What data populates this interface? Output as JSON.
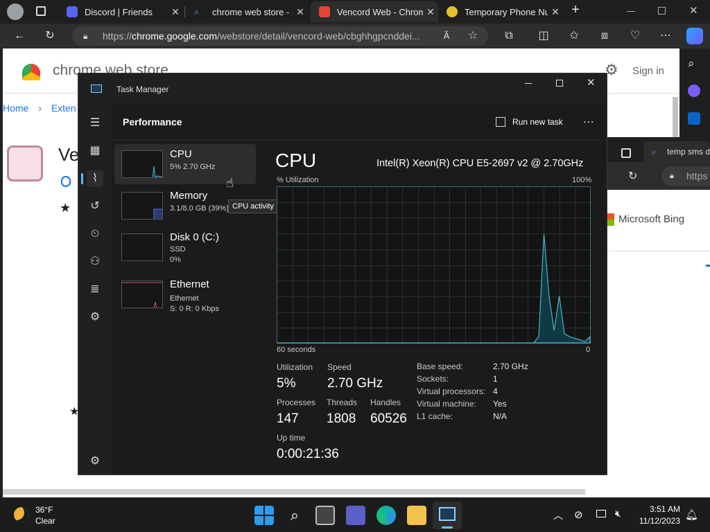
{
  "browser": {
    "tabs": [
      {
        "title": "Discord | Friends",
        "favicon_color": "#5865f2",
        "active": false
      },
      {
        "title": "chrome web store - Se",
        "favicon_color": "#3b82f6",
        "active": false
      },
      {
        "title": "Vencord Web - Chrom",
        "favicon_color": "#ea4335",
        "active": true
      },
      {
        "title": "Temporary Phone Nun",
        "favicon_color": "#e6c229",
        "active": false
      }
    ],
    "new_tab_label": "+",
    "url_prefix": "https://",
    "url_domain": "chrome.google.com",
    "url_rest": "/webstore/detail/vencord-web/cbghhgpcnddei..."
  },
  "store": {
    "brand": "chrome web store",
    "sign_in": "Sign in",
    "breadcrumb_home": "Home",
    "breadcrumb_next": "Exten",
    "title_partial": "Ve"
  },
  "second_window": {
    "tab_label": "temp sms d",
    "url_partial": "https",
    "bing": "Microsoft Bing"
  },
  "task_manager": {
    "title": "Task Manager",
    "page_title": "Performance",
    "run_new_task": "Run new task",
    "more_label": "...",
    "tooltip": "CPU activity",
    "tiles": [
      {
        "name": "CPU",
        "sub1": "5% 2.70 GHz",
        "sub2": "",
        "sub3": ""
      },
      {
        "name": "Memory",
        "sub1": "3.1/8.0 GB (39%)",
        "sub2": "",
        "sub3": ""
      },
      {
        "name": "Disk 0 (C:)",
        "sub1": "SSD",
        "sub2": "0%",
        "sub3": ""
      },
      {
        "name": "Ethernet",
        "sub1": "Ethernet",
        "sub2": "S: 0 R: 0 Kbps",
        "sub3": ""
      }
    ],
    "cpu": {
      "heading": "CPU",
      "model": "Intel(R) Xeon(R) CPU E5-2697 v2 @ 2.70GHz",
      "util_label": "% Utilization",
      "util_max": "100%",
      "x_left": "60 seconds",
      "x_right": "0",
      "graph_line_color": "#4bb3c8",
      "utilization_history": [
        0,
        0,
        0,
        0,
        0,
        0,
        0,
        0,
        0,
        0,
        0,
        0,
        0,
        0,
        0,
        0,
        0,
        0,
        0,
        0,
        0,
        0,
        0,
        0,
        0,
        0,
        0,
        0,
        0,
        0,
        0,
        0,
        0,
        0,
        0,
        0,
        0,
        0,
        0,
        0,
        0,
        0,
        0,
        0,
        0,
        0,
        0,
        0,
        0,
        0,
        0,
        4,
        70,
        30,
        8,
        30,
        6,
        4,
        3,
        2,
        1,
        4
      ],
      "stats": {
        "utilization_label": "Utilization",
        "utilization": "5%",
        "speed_label": "Speed",
        "speed": "2.70 GHz",
        "processes_label": "Processes",
        "processes": "147",
        "threads_label": "Threads",
        "threads": "1808",
        "handles_label": "Handles",
        "handles": "60526",
        "uptime_label": "Up time",
        "uptime": "0:00:21:36"
      },
      "specs": [
        {
          "label": "Base speed:",
          "value": "2.70 GHz"
        },
        {
          "label": "Sockets:",
          "value": "1"
        },
        {
          "label": "Virtual processors:",
          "value": "4"
        },
        {
          "label": "Virtual machine:",
          "value": "Yes"
        },
        {
          "label": "L1 cache:",
          "value": "N/A"
        }
      ]
    }
  },
  "taskbar": {
    "weather_temp": "36°F",
    "weather_desc": "Clear",
    "time": "3:51 AM",
    "date": "11/12/2023"
  }
}
